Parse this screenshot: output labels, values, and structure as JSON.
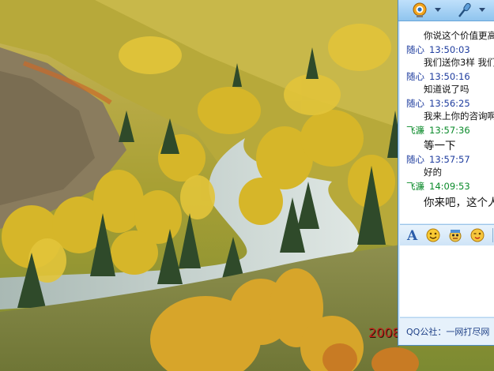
{
  "qq_window": {
    "toolbar": {
      "buttons": [
        {
          "name": "video-call",
          "icon": "webcam-icon"
        },
        {
          "name": "voice-call",
          "icon": "microphone-icon"
        }
      ]
    },
    "messages": [
      {
        "sender": "",
        "time": "",
        "text": "你说这个价值更高",
        "partial_top": true
      },
      {
        "sender": "随心",
        "time": "13:50:03",
        "text": "我们送你3样 我们",
        "color": "blue"
      },
      {
        "sender": "随心",
        "time": "13:50:16",
        "text": "知道说了吗",
        "color": "blue"
      },
      {
        "sender": "随心",
        "time": "13:56:25",
        "text": "我来上你的咨询啊",
        "color": "blue"
      },
      {
        "sender": "飞濂",
        "time": "13:57:36",
        "text": "等一下",
        "color": "green"
      },
      {
        "sender": "随心",
        "time": "13:57:57",
        "text": "好的",
        "color": "blue"
      },
      {
        "sender": "飞濂",
        "time": "14:09:53",
        "text": "你来吧，这个人",
        "color": "green"
      }
    ],
    "format_toolbar": [
      "font-icon",
      "smiley-icon",
      "magic-face-icon",
      "wink-face-icon"
    ],
    "notice": {
      "label": "QQ公社：",
      "text": "一网打尽网"
    }
  },
  "wallpaper": {
    "watermark": "2008"
  },
  "colors": {
    "qq_blue": "#d7ebfb",
    "sender_blue": "#1e3c9e",
    "sender_green": "#0a8a2a"
  }
}
